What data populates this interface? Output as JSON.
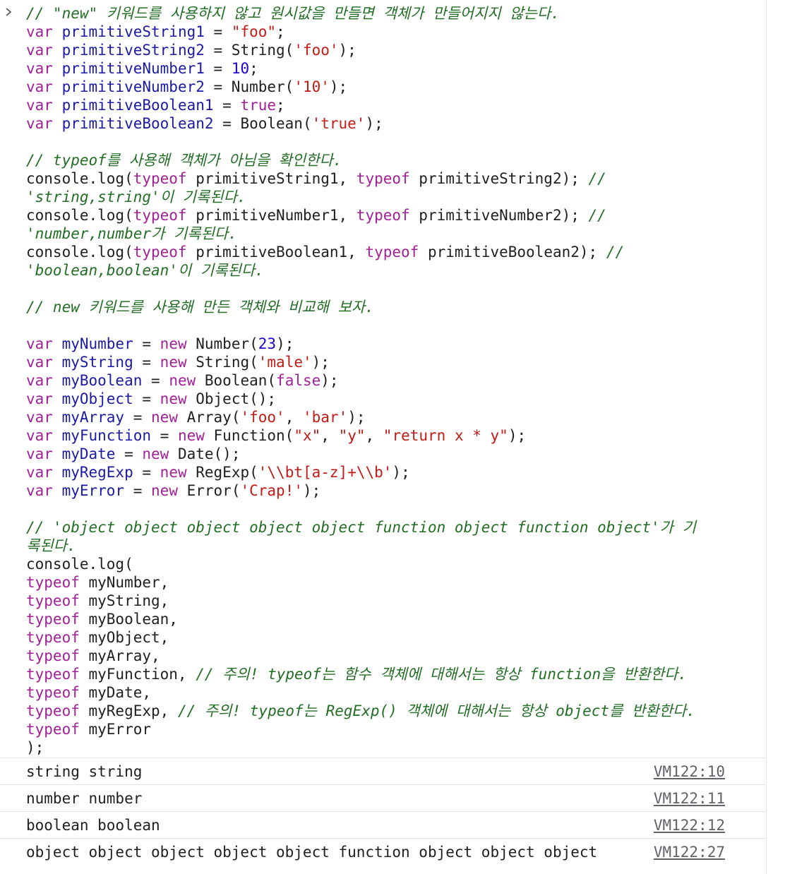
{
  "input": {
    "lines": [
      [
        {
          "t": "cm",
          "v": "// \"new\" 키워드를 사용하지 않고 원시값을 만들면 객체가 만들어지지 않는다."
        }
      ],
      [
        {
          "t": "kw",
          "v": "var "
        },
        {
          "t": "var",
          "v": "primitiveString1"
        },
        {
          "t": "p",
          "v": " = "
        },
        {
          "t": "str",
          "v": "\"foo\""
        },
        {
          "t": "p",
          "v": ";"
        }
      ],
      [
        {
          "t": "kw",
          "v": "var "
        },
        {
          "t": "var",
          "v": "primitiveString2"
        },
        {
          "t": "p",
          "v": " = String("
        },
        {
          "t": "str",
          "v": "'foo'"
        },
        {
          "t": "p",
          "v": ");"
        }
      ],
      [
        {
          "t": "kw",
          "v": "var "
        },
        {
          "t": "var",
          "v": "primitiveNumber1"
        },
        {
          "t": "p",
          "v": " = "
        },
        {
          "t": "num",
          "v": "10"
        },
        {
          "t": "p",
          "v": ";"
        }
      ],
      [
        {
          "t": "kw",
          "v": "var "
        },
        {
          "t": "var",
          "v": "primitiveNumber2"
        },
        {
          "t": "p",
          "v": " = Number("
        },
        {
          "t": "str",
          "v": "'10'"
        },
        {
          "t": "p",
          "v": ");"
        }
      ],
      [
        {
          "t": "kw",
          "v": "var "
        },
        {
          "t": "var",
          "v": "primitiveBoolean1"
        },
        {
          "t": "p",
          "v": " = "
        },
        {
          "t": "kw",
          "v": "true"
        },
        {
          "t": "p",
          "v": ";"
        }
      ],
      [
        {
          "t": "kw",
          "v": "var "
        },
        {
          "t": "var",
          "v": "primitiveBoolean2"
        },
        {
          "t": "p",
          "v": " = Boolean("
        },
        {
          "t": "str",
          "v": "'true'"
        },
        {
          "t": "p",
          "v": ");"
        }
      ],
      [],
      [
        {
          "t": "cm",
          "v": "// typeof를 사용해 객체가 아님을 확인한다."
        }
      ],
      [
        {
          "t": "p",
          "v": "console.log("
        },
        {
          "t": "kw",
          "v": "typeof"
        },
        {
          "t": "p",
          "v": " primitiveString1, "
        },
        {
          "t": "kw",
          "v": "typeof"
        },
        {
          "t": "p",
          "v": " primitiveString2); "
        },
        {
          "t": "cm",
          "v": "//"
        }
      ],
      [
        {
          "t": "cm",
          "v": "'string,string'이 기록된다."
        }
      ],
      [
        {
          "t": "p",
          "v": "console.log("
        },
        {
          "t": "kw",
          "v": "typeof"
        },
        {
          "t": "p",
          "v": " primitiveNumber1, "
        },
        {
          "t": "kw",
          "v": "typeof"
        },
        {
          "t": "p",
          "v": " primitiveNumber2); "
        },
        {
          "t": "cm",
          "v": "//"
        }
      ],
      [
        {
          "t": "cm",
          "v": "'number,number가 기록된다."
        }
      ],
      [
        {
          "t": "p",
          "v": "console.log("
        },
        {
          "t": "kw",
          "v": "typeof"
        },
        {
          "t": "p",
          "v": " primitiveBoolean1, "
        },
        {
          "t": "kw",
          "v": "typeof"
        },
        {
          "t": "p",
          "v": " primitiveBoolean2); "
        },
        {
          "t": "cm",
          "v": "//"
        }
      ],
      [
        {
          "t": "cm",
          "v": "'boolean,boolean'이 기록된다."
        }
      ],
      [],
      [
        {
          "t": "cm",
          "v": "// new 키워드를 사용해 만든 객체와 비교해 보자."
        }
      ],
      [],
      [
        {
          "t": "kw",
          "v": "var "
        },
        {
          "t": "var",
          "v": "myNumber"
        },
        {
          "t": "p",
          "v": " = "
        },
        {
          "t": "kw",
          "v": "new"
        },
        {
          "t": "p",
          "v": " Number("
        },
        {
          "t": "num",
          "v": "23"
        },
        {
          "t": "p",
          "v": ");"
        }
      ],
      [
        {
          "t": "kw",
          "v": "var "
        },
        {
          "t": "var",
          "v": "myString"
        },
        {
          "t": "p",
          "v": " = "
        },
        {
          "t": "kw",
          "v": "new"
        },
        {
          "t": "p",
          "v": " String("
        },
        {
          "t": "str",
          "v": "'male'"
        },
        {
          "t": "p",
          "v": ");"
        }
      ],
      [
        {
          "t": "kw",
          "v": "var "
        },
        {
          "t": "var",
          "v": "myBoolean"
        },
        {
          "t": "p",
          "v": " = "
        },
        {
          "t": "kw",
          "v": "new"
        },
        {
          "t": "p",
          "v": " Boolean("
        },
        {
          "t": "kw",
          "v": "false"
        },
        {
          "t": "p",
          "v": ");"
        }
      ],
      [
        {
          "t": "kw",
          "v": "var "
        },
        {
          "t": "var",
          "v": "myObject"
        },
        {
          "t": "p",
          "v": " = "
        },
        {
          "t": "kw",
          "v": "new"
        },
        {
          "t": "p",
          "v": " Object();"
        }
      ],
      [
        {
          "t": "kw",
          "v": "var "
        },
        {
          "t": "var",
          "v": "myArray"
        },
        {
          "t": "p",
          "v": " = "
        },
        {
          "t": "kw",
          "v": "new"
        },
        {
          "t": "p",
          "v": " Array("
        },
        {
          "t": "str",
          "v": "'foo'"
        },
        {
          "t": "p",
          "v": ", "
        },
        {
          "t": "str",
          "v": "'bar'"
        },
        {
          "t": "p",
          "v": ");"
        }
      ],
      [
        {
          "t": "kw",
          "v": "var "
        },
        {
          "t": "var",
          "v": "myFunction"
        },
        {
          "t": "p",
          "v": " = "
        },
        {
          "t": "kw",
          "v": "new"
        },
        {
          "t": "p",
          "v": " Function("
        },
        {
          "t": "str",
          "v": "\"x\""
        },
        {
          "t": "p",
          "v": ", "
        },
        {
          "t": "str",
          "v": "\"y\""
        },
        {
          "t": "p",
          "v": ", "
        },
        {
          "t": "str",
          "v": "\"return x * y\""
        },
        {
          "t": "p",
          "v": ");"
        }
      ],
      [
        {
          "t": "kw",
          "v": "var "
        },
        {
          "t": "var",
          "v": "myDate"
        },
        {
          "t": "p",
          "v": " = "
        },
        {
          "t": "kw",
          "v": "new"
        },
        {
          "t": "p",
          "v": " Date();"
        }
      ],
      [
        {
          "t": "kw",
          "v": "var "
        },
        {
          "t": "var",
          "v": "myRegExp"
        },
        {
          "t": "p",
          "v": " = "
        },
        {
          "t": "kw",
          "v": "new"
        },
        {
          "t": "p",
          "v": " RegExp("
        },
        {
          "t": "str",
          "v": "'\\\\bt[a-z]+\\\\b'"
        },
        {
          "t": "p",
          "v": ");"
        }
      ],
      [
        {
          "t": "kw",
          "v": "var "
        },
        {
          "t": "var",
          "v": "myError"
        },
        {
          "t": "p",
          "v": " = "
        },
        {
          "t": "kw",
          "v": "new"
        },
        {
          "t": "p",
          "v": " Error("
        },
        {
          "t": "str",
          "v": "'Crap!'"
        },
        {
          "t": "p",
          "v": ");"
        }
      ],
      [],
      [
        {
          "t": "cm",
          "v": "// 'object object object object object function object function object'가 기"
        }
      ],
      [
        {
          "t": "cm",
          "v": "록된다."
        }
      ],
      [
        {
          "t": "p",
          "v": "console.log("
        }
      ],
      [
        {
          "t": "kw",
          "v": "typeof"
        },
        {
          "t": "p",
          "v": " myNumber,"
        }
      ],
      [
        {
          "t": "kw",
          "v": "typeof"
        },
        {
          "t": "p",
          "v": " myString,"
        }
      ],
      [
        {
          "t": "kw",
          "v": "typeof"
        },
        {
          "t": "p",
          "v": " myBoolean,"
        }
      ],
      [
        {
          "t": "kw",
          "v": "typeof"
        },
        {
          "t": "p",
          "v": " myObject,"
        }
      ],
      [
        {
          "t": "kw",
          "v": "typeof"
        },
        {
          "t": "p",
          "v": " myArray,"
        }
      ],
      [
        {
          "t": "kw",
          "v": "typeof"
        },
        {
          "t": "p",
          "v": " myFunction, "
        },
        {
          "t": "cm",
          "v": "// 주의! typeof는 함수 객체에 대해서는 항상 function을 반환한다."
        }
      ],
      [
        {
          "t": "kw",
          "v": "typeof"
        },
        {
          "t": "p",
          "v": " myDate,"
        }
      ],
      [
        {
          "t": "kw",
          "v": "typeof"
        },
        {
          "t": "p",
          "v": " myRegExp, "
        },
        {
          "t": "cm",
          "v": "// 주의! typeof는 RegExp() 객체에 대해서는 항상 object를 반환한다."
        }
      ],
      [
        {
          "t": "kw",
          "v": "typeof"
        },
        {
          "t": "p",
          "v": " myError"
        }
      ],
      [
        {
          "t": "p",
          "v": ");"
        }
      ]
    ]
  },
  "outputs": [
    {
      "text": "string string",
      "source": "VM122:10"
    },
    {
      "text": "number number",
      "source": "VM122:11"
    },
    {
      "text": "boolean boolean",
      "source": "VM122:12"
    },
    {
      "text": "object object object object object function object object object",
      "source": "VM122:27"
    }
  ],
  "icons": {
    "prompt": "chevron-right-icon"
  },
  "colors": {
    "keyword": "#a41f98",
    "variable": "#1a1aa6",
    "string": "#c41a16",
    "number": "#1c00cf",
    "comment": "#236e25"
  }
}
